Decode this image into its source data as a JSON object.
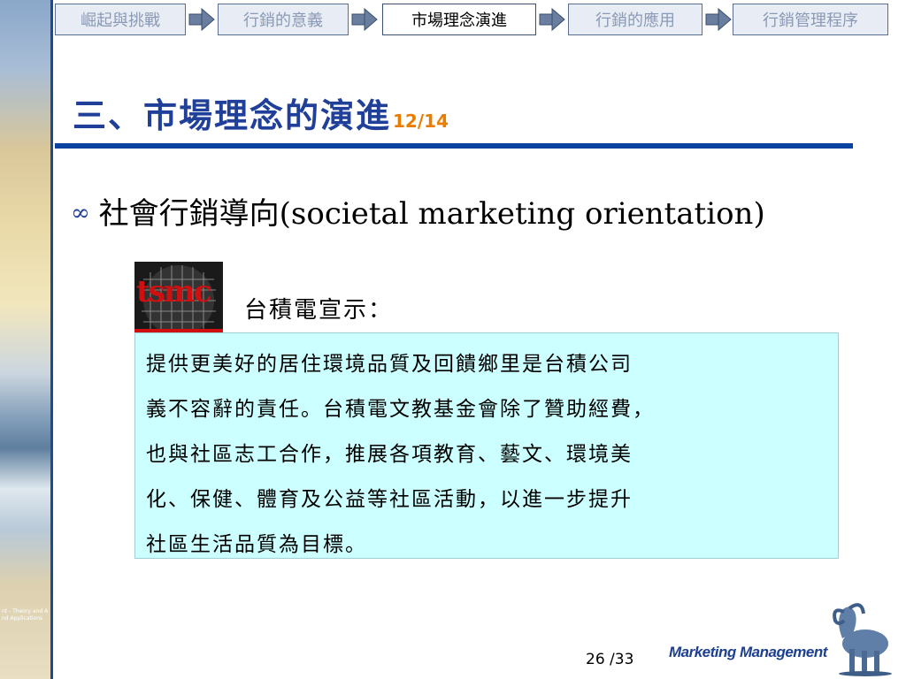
{
  "nav": {
    "tabs": [
      {
        "label": "崛起與挑戰",
        "active": false
      },
      {
        "label": "行銷的意義",
        "active": false
      },
      {
        "label": "市場理念演進",
        "active": true
      },
      {
        "label": "行銷的應用",
        "active": false
      },
      {
        "label": "行銷管理程序",
        "active": false
      }
    ]
  },
  "slide": {
    "title": "三、市場理念的演進",
    "title_counter": "12/14",
    "bullet": "社會行銷導向(societal marketing orientation)",
    "logo_text": "tsmc",
    "subheading": "台積電宣示：",
    "quote_lines": [
      "提供更美好的居住環境品質及回饋鄉里是台積公司",
      "義不容辭的責任。台積電文教基金會除了贊助經費，",
      "也與社區志工合作，推展各項教育、藝文、環境美",
      "化、保健、體育及公益等社區活動，以進一步提升",
      "社區生活品質為目標。"
    ]
  },
  "sidebar": {
    "text_upper": "",
    "text_lower": "nt - Theory and A nd Applications"
  },
  "footer": {
    "page_label": "26 /33",
    "brand": "Marketing Management"
  },
  "colors": {
    "title": "#1f3f99",
    "counter": "#e87d00",
    "rule": "#0b44a0",
    "box_bg": "#ccffff",
    "brand": "#1d3f8f"
  }
}
